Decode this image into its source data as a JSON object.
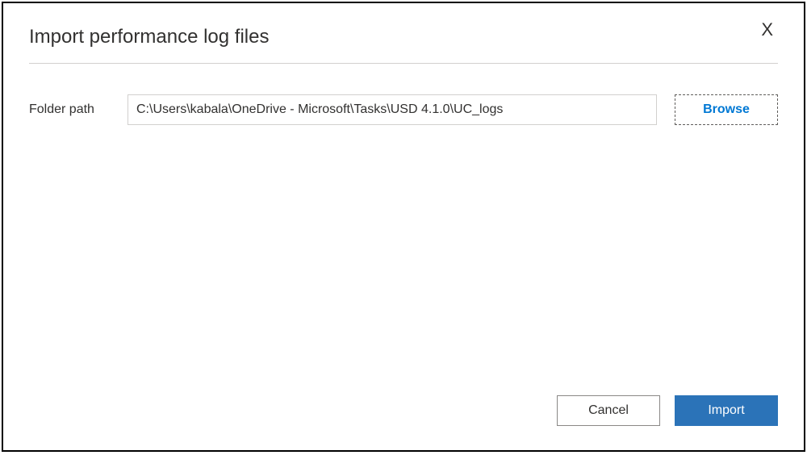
{
  "dialog": {
    "title": "Import performance log files",
    "close_label": "X"
  },
  "form": {
    "folder_label": "Folder path",
    "folder_value": "C:\\Users\\kabala\\OneDrive - Microsoft\\Tasks\\USD 4.1.0\\UC_logs",
    "browse_label": "Browse"
  },
  "footer": {
    "cancel_label": "Cancel",
    "import_label": "Import"
  }
}
